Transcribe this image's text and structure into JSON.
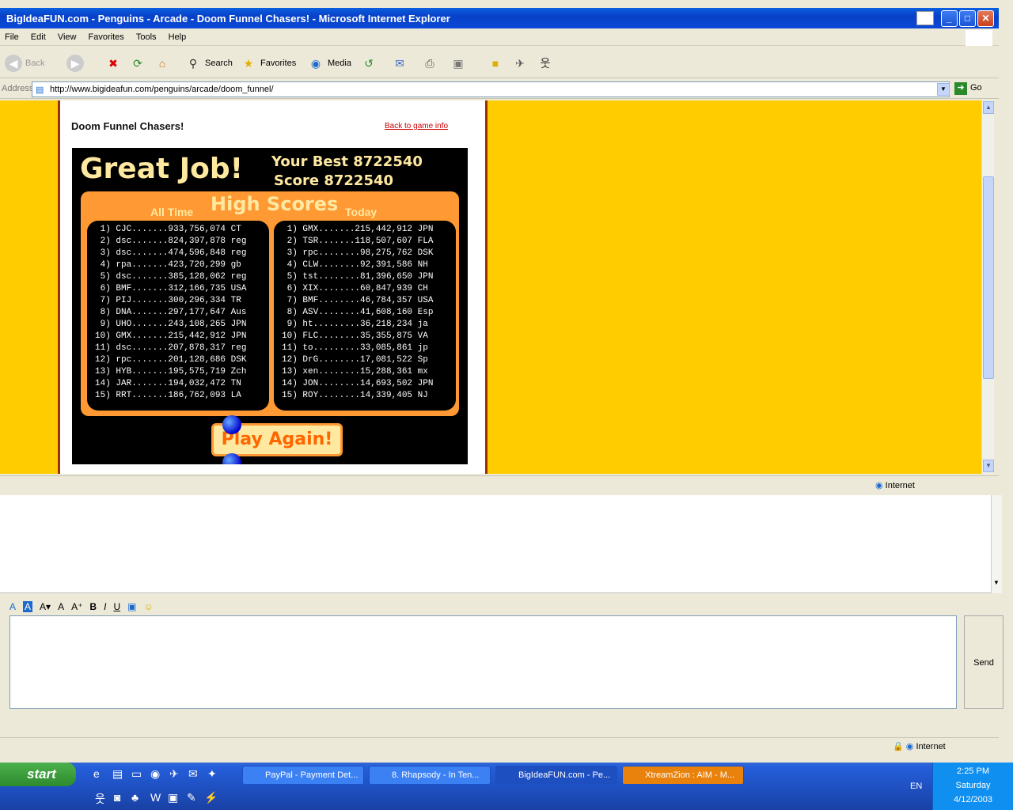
{
  "window": {
    "title": "BigIdeaFUN.com - Penguins - Arcade - Doom Funnel Chasers! - Microsoft Internet Explorer"
  },
  "menu": [
    "File",
    "Edit",
    "View",
    "Favorites",
    "Tools",
    "Help"
  ],
  "toolbar": {
    "back": "Back",
    "search": "Search",
    "favorites": "Favorites",
    "media": "Media"
  },
  "address": {
    "label": "Address",
    "url": "http://www.bigideafun.com/penguins/arcade/doom_funnel/",
    "go": "Go"
  },
  "page": {
    "game_title": "Doom Funnel Chasers!",
    "back_link": "Back to game info",
    "great_job": "Great Job!",
    "best_line": "Your Best 8722540",
    "score_line": "Score 8722540",
    "high_scores": "High Scores",
    "all_time_label": "All Time",
    "today_label": "Today",
    "play_again": "Play Again!",
    "all_time": [
      " 1) CJC.......933,756,074 CT",
      " 2) dsc.......824,397,878 reg",
      " 3) dsc.......474,596,848 reg",
      " 4) rpa.......423,720,299 gb",
      " 5) dsc.......385,128,062 reg",
      " 6) BMF.......312,166,735 USA",
      " 7) PIJ.......300,296,334 TR",
      " 8) DNA.......297,177,647 Aus",
      " 9) UHO.......243,108,265 JPN",
      "10) GMX.......215,442,912 JPN",
      "11) dsc.......207,878,317 reg",
      "12) rpc.......201,128,686 DSK",
      "13) HYB.......195,575,719 Zch",
      "14) JAR.......194,032,472 TN",
      "15) RRT.......186,762,093 LA"
    ],
    "today": [
      " 1) GMX.......215,442,912 JPN",
      " 2) TSR.......118,507,607 FLA",
      " 3) rpc........98,275,762 DSK",
      " 4) CLW........92,391,586 NH",
      " 5) tst........81,396,650 JPN",
      " 6) XIX........60,847,939 CH",
      " 7) BMF........46,784,357 USA",
      " 8) ASV........41,608,160 Esp",
      " 9) ht.........36,218,234 ja",
      "10) FLC........35,355,875 VA",
      "11) to.........33,085,861 jp",
      "12) DrG........17,081,522 Sp",
      "13) xen........15,288,361 mx",
      "14) JON........14,693,502 JPN",
      "15) ROY........14,339,405 NJ"
    ]
  },
  "status": {
    "zone": "Internet"
  },
  "aim": {
    "send": "Send",
    "zone": "Internet"
  },
  "taskbar": {
    "start": "start",
    "tasks": [
      "PayPal - Payment Det...",
      "8. Rhapsody - In Ten...",
      "BigIdeaFUN.com - Pe...",
      "XtreamZion : AIM - M..."
    ],
    "lang": "EN",
    "time": "2:25 PM",
    "day": "Saturday",
    "date": "4/12/2003"
  }
}
